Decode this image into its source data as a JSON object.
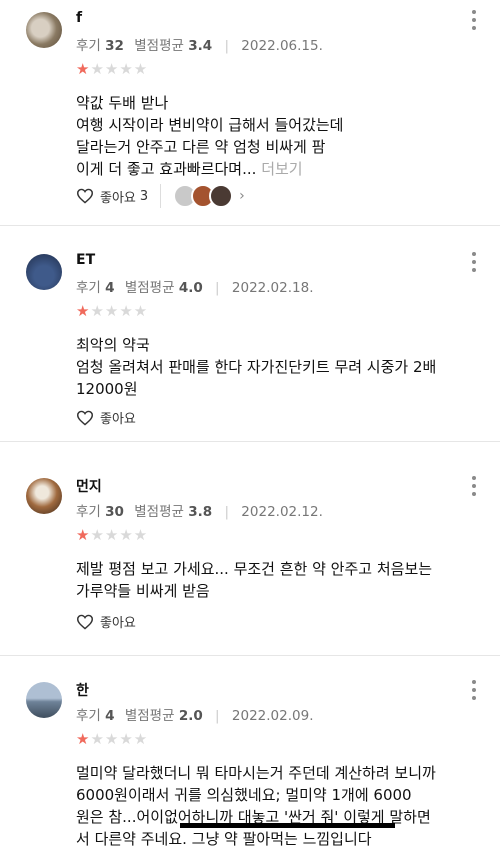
{
  "reviews": [
    {
      "name": "f",
      "review_label": "후기",
      "review_count": "32",
      "avg_label": "별점평균",
      "avg": "3.4",
      "date": "2022.06.15.",
      "rating": 1,
      "lines": [
        "약값 두배 받나",
        "여행 시작이라 변비약이 급해서 들어갔는데",
        "달라는거 안주고 다른 약 엄청 비싸게 팜",
        "이게 더 좋고 효과빠르다며..."
      ],
      "more": "더보기",
      "like_label": "좋아요",
      "like_count": "3"
    },
    {
      "name": "ET",
      "review_label": "후기",
      "review_count": "4",
      "avg_label": "별점평균",
      "avg": "4.0",
      "date": "2022.02.18.",
      "rating": 1,
      "lines": [
        "최악의 약국",
        "엄청 올려쳐서 판매를 한다 자가진단키트 무려 시중가 2배",
        "12000원"
      ],
      "like_label": "좋아요"
    },
    {
      "name": "먼지",
      "review_label": "후기",
      "review_count": "30",
      "avg_label": "별점평균",
      "avg": "3.8",
      "date": "2022.02.12.",
      "rating": 1,
      "lines": [
        "제발 평점 보고 가세요... 무조건 흔한 약 안주고 처음보는",
        "가루약들 비싸게 받음"
      ],
      "like_label": "좋아요"
    },
    {
      "name": "한",
      "review_label": "후기",
      "review_count": "4",
      "avg_label": "별점평균",
      "avg": "2.0",
      "date": "2022.02.09.",
      "rating": 1,
      "lines": [
        "멀미약 달라했더니 뭐 타마시는거 주던데 계산하려 보니까",
        "6000원이래서 귀를 의심했네요; 멀미약 1개에 6000",
        "원은 참...어이없어하니까 대놓고 '싼거 줘' 이렇게 말하면",
        "서 다른약 주네요. 그냥 약 팔아먹는 느낌입니다"
      ]
    }
  ]
}
